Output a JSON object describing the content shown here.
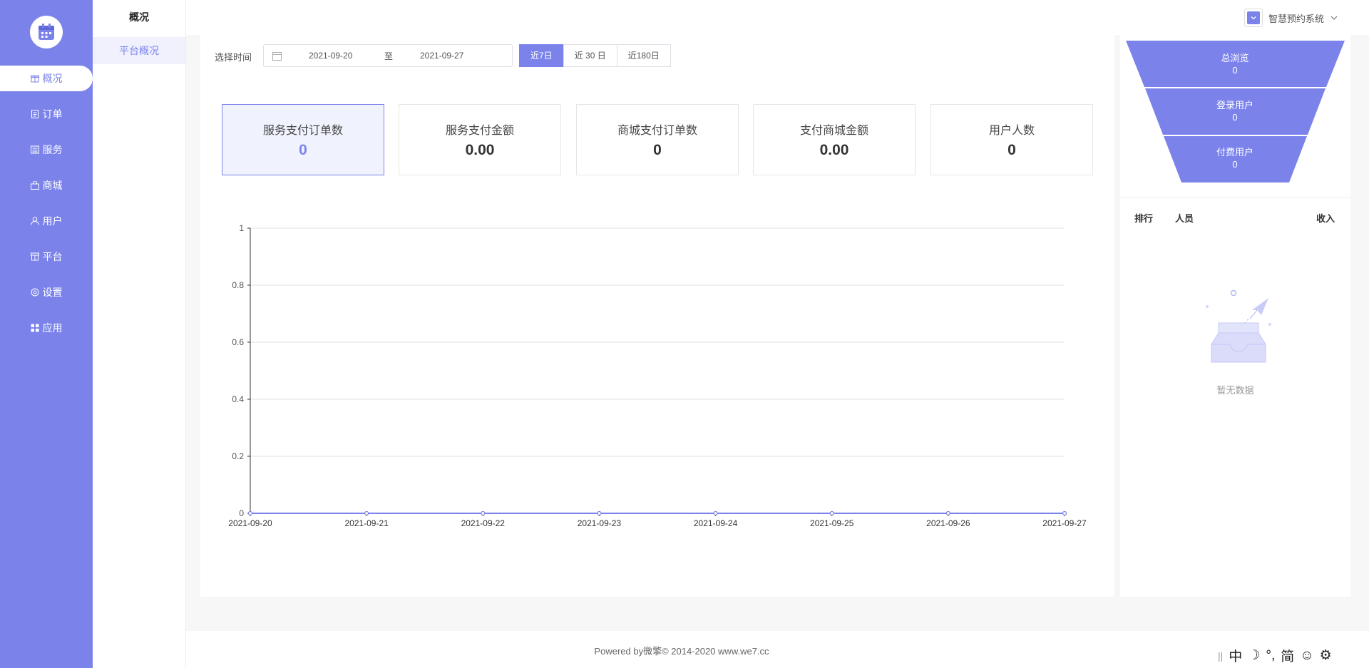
{
  "sidebar": {
    "items": [
      {
        "label": "概况",
        "icon": "gift-icon",
        "active": true
      },
      {
        "label": "订单",
        "icon": "document-icon",
        "active": false
      },
      {
        "label": "服务",
        "icon": "list-icon",
        "active": false
      },
      {
        "label": "商城",
        "icon": "bag-icon",
        "active": false
      },
      {
        "label": "用户",
        "icon": "user-icon",
        "active": false
      },
      {
        "label": "平台",
        "icon": "platform-icon",
        "active": false
      },
      {
        "label": "设置",
        "icon": "gear-icon",
        "active": false
      },
      {
        "label": "应用",
        "icon": "apps-icon",
        "active": false
      }
    ]
  },
  "subnav": {
    "title": "概况",
    "item": "平台概况"
  },
  "topbar": {
    "system_name": "智慧预约系统"
  },
  "filter": {
    "label": "选择时间",
    "start_date": "2021-09-20",
    "separator": "至",
    "end_date": "2021-09-27",
    "quick": [
      "近7日",
      "近 30 日",
      "近180日"
    ],
    "quick_active": 0
  },
  "stats": [
    {
      "title": "服务支付订单数",
      "value": "0"
    },
    {
      "title": "服务支付金额",
      "value": "0.00"
    },
    {
      "title": "商城支付订单数",
      "value": "0"
    },
    {
      "title": "支付商城金额",
      "value": "0.00"
    },
    {
      "title": "用户人数",
      "value": "0"
    }
  ],
  "chart_data": {
    "type": "line",
    "x": [
      "2021-09-20",
      "2021-09-21",
      "2021-09-22",
      "2021-09-23",
      "2021-09-24",
      "2021-09-25",
      "2021-09-26",
      "2021-09-27"
    ],
    "series": [
      {
        "values": [
          0,
          0,
          0,
          0,
          0,
          0,
          0,
          0
        ]
      }
    ],
    "yticks": [
      "0",
      "0.2",
      "0.4",
      "0.6",
      "0.8",
      "1"
    ],
    "ylim": [
      0,
      1
    ],
    "grid": true,
    "color": "#7b83eb"
  },
  "funnel": [
    {
      "label": "总浏览",
      "value": "0"
    },
    {
      "label": "登录用户",
      "value": "0"
    },
    {
      "label": "付费用户",
      "value": "0"
    }
  ],
  "ranking": {
    "col_rank": "排行",
    "col_person": "人员",
    "col_income": "收入",
    "empty": "暂无数据"
  },
  "footer": {
    "text": "Powered by微擎© 2014-2020 www.we7.cc"
  },
  "ime": [
    "中",
    "☽",
    "°,",
    "简",
    "☺",
    "⚙"
  ],
  "colors": {
    "accent": "#7b83eb"
  }
}
